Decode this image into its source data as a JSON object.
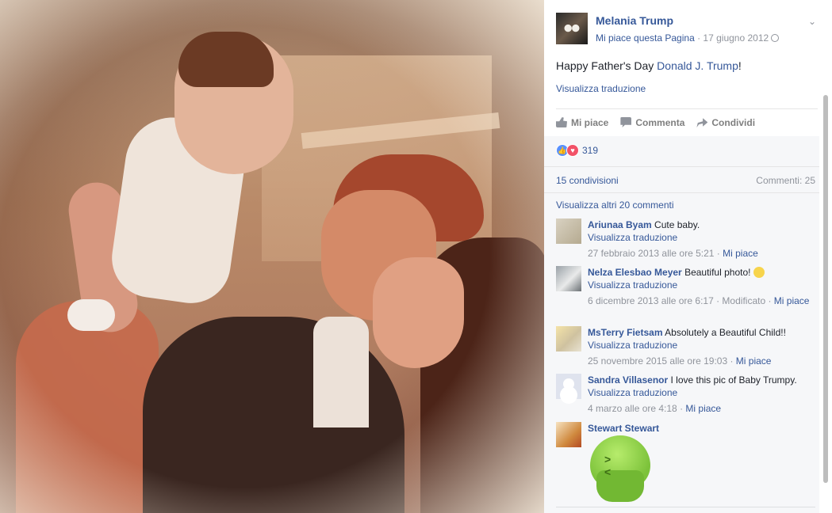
{
  "post": {
    "page_name": "Melania Trump",
    "like_page": "Mi piace questa Pagina",
    "separator": " · ",
    "date": "17 giugno 2012",
    "text_before": "Happy Father's Day ",
    "mention": "Donald J. Trump",
    "text_after": "!",
    "translate": "Visualizza traduzione"
  },
  "actions": {
    "like": "Mi piace",
    "comment": "Commenta",
    "share": "Condividi"
  },
  "stats": {
    "reactions": "319",
    "shares": "15 condivisioni",
    "comments": "Commenti: 25",
    "more_comments": "Visualizza altri 20 commenti"
  },
  "comments": [
    {
      "author": "Ariunaa Byam",
      "text": " Cute baby.",
      "translate": "Visualizza traduzione",
      "meta": "27 febbraio 2013 alle ore 5:21 · ",
      "like": "Mi piace"
    },
    {
      "author": "Nelza Elesbao Meyer",
      "text": " Beautiful photo! ",
      "translate": "Visualizza traduzione",
      "meta": "6 dicembre 2013 alle ore 6:17 · Modificato · ",
      "like": "Mi piace"
    },
    {
      "author": "MsTerry Fietsam",
      "text": " Absolutely a Beautiful Child!!",
      "translate": "Visualizza traduzione",
      "meta": "25 novembre 2015 alle ore 19:03 · ",
      "like": "Mi piace"
    },
    {
      "author": "Sandra Villasenor",
      "text": " I love this pic of Baby Trumpy.",
      "translate": "Visualizza traduzione",
      "meta": "4 marzo alle ore 4:18 · ",
      "like": "Mi piace"
    },
    {
      "author": "Stewart Stewart",
      "sticker": "sick-sticker"
    }
  ],
  "colors": {
    "link": "#365899",
    "muted": "#90949c",
    "like_reaction": "#5890ff",
    "love_reaction": "#f25268"
  },
  "icons": [
    "globe-icon",
    "chevron-down-icon",
    "like-icon",
    "comment-icon",
    "share-icon",
    "smiley-emoji"
  ]
}
